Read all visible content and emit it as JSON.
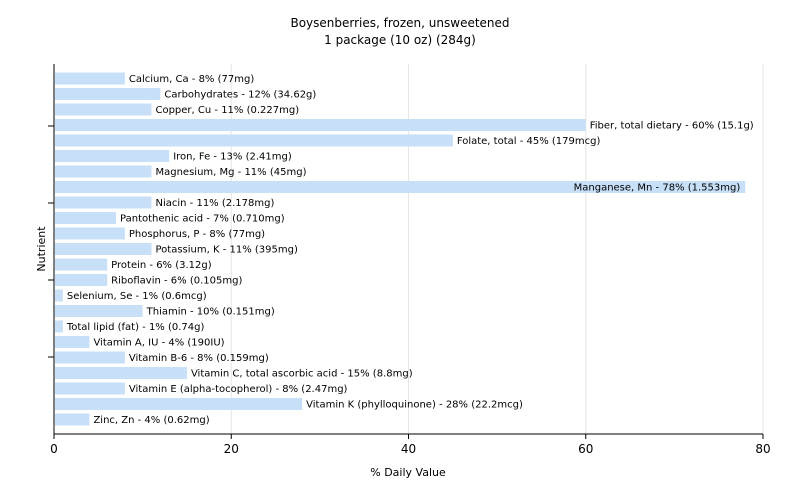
{
  "chart_data": {
    "type": "bar",
    "orientation": "horizontal",
    "title": "Boysenberries, frozen, unsweetened",
    "subtitle": "1 package (10 oz) (284g)",
    "xlabel": "% Daily Value",
    "ylabel": "Nutrient",
    "xlim": [
      0,
      80
    ],
    "xticks": [
      0,
      20,
      40,
      60,
      80
    ],
    "grid": true,
    "bar_color": "#c7dff7",
    "grid_color": "#e6e6e6",
    "categories": [
      "Calcium, Ca",
      "Carbohydrates",
      "Copper, Cu",
      "Fiber, total dietary",
      "Folate, total",
      "Iron, Fe",
      "Magnesium, Mg",
      "Manganese, Mn",
      "Niacin",
      "Pantothenic acid",
      "Phosphorus, P",
      "Potassium, K",
      "Protein",
      "Riboflavin",
      "Selenium, Se",
      "Thiamin",
      "Total lipid (fat)",
      "Vitamin A, IU",
      "Vitamin B-6",
      "Vitamin C, total ascorbic acid",
      "Vitamin E (alpha-tocopherol)",
      "Vitamin K (phylloquinone)",
      "Zinc, Zn"
    ],
    "values": [
      8,
      12,
      11,
      60,
      45,
      13,
      11,
      78,
      11,
      7,
      8,
      11,
      6,
      6,
      1,
      10,
      1,
      4,
      8,
      15,
      8,
      28,
      4
    ],
    "labels": [
      "Calcium, Ca - 8% (77mg)",
      "Carbohydrates - 12% (34.62g)",
      "Copper, Cu - 11% (0.227mg)",
      "Fiber, total dietary - 60% (15.1g)",
      "Folate, total - 45% (179mcg)",
      "Iron, Fe - 13% (2.41mg)",
      "Magnesium, Mg - 11% (45mg)",
      "Manganese, Mn - 78% (1.553mg)",
      "Niacin - 11% (2.178mg)",
      "Pantothenic acid - 7% (0.710mg)",
      "Phosphorus, P - 8% (77mg)",
      "Potassium, K - 11% (395mg)",
      "Protein - 6% (3.12g)",
      "Riboflavin - 6% (0.105mg)",
      "Selenium, Se - 1% (0.6mcg)",
      "Thiamin - 10% (0.151mg)",
      "Total lipid (fat) - 1% (0.74g)",
      "Vitamin A, IU - 4% (190IU)",
      "Vitamin B-6 - 8% (0.159mg)",
      "Vitamin C, total ascorbic acid - 15% (8.8mg)",
      "Vitamin E (alpha-tocopherol) - 8% (2.47mg)",
      "Vitamin K (phylloquinone) - 28% (22.2mcg)",
      "Zinc, Zn - 4% (0.62mg)"
    ]
  }
}
